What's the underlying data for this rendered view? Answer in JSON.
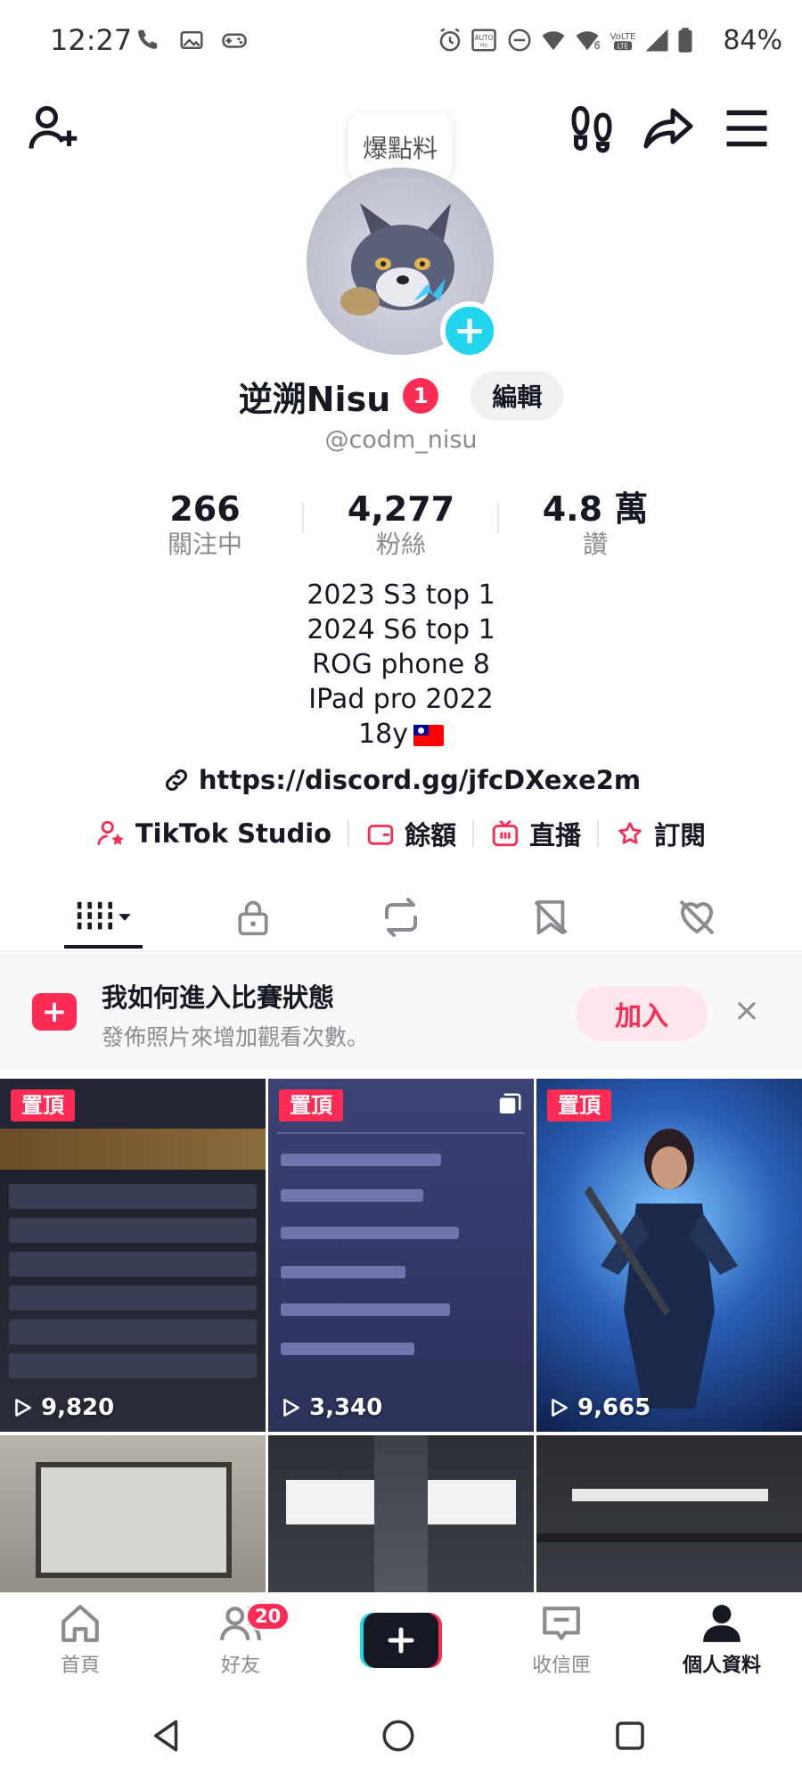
{
  "status_bar": {
    "time": "12:27",
    "battery": "84%",
    "icons_left": [
      "phone-icon",
      "image-icon",
      "gamepad-icon"
    ],
    "icons_right": [
      "alarm-icon",
      "auto-hz-icon",
      "dnd-icon",
      "wifi-icon",
      "wifi6-icon",
      "volte-icon",
      "signal-icon",
      "battery-icon"
    ]
  },
  "top_bar": {
    "bubble_text": "爆點料"
  },
  "profile": {
    "name": "逆溯Nisu",
    "name_badge": "1",
    "edit_label": "編輯",
    "handle": "@codm_nisu"
  },
  "stats": [
    {
      "value": "266",
      "label": "關注中"
    },
    {
      "value": "4,277",
      "label": "粉絲"
    },
    {
      "value": "4.8 萬",
      "label": "讚"
    }
  ],
  "bio": {
    "lines": [
      "2023 S3 top 1",
      "2024 S6 top 1",
      "ROG phone 8",
      "IPad pro 2022",
      "18y"
    ],
    "flag": "taiwan-flag"
  },
  "link": "https://discord.gg/jfcDXexe2m",
  "quick_links": [
    {
      "label": "TikTok Studio",
      "icon": "person-star-icon"
    },
    {
      "label": "餘額",
      "icon": "wallet-icon"
    },
    {
      "label": "直播",
      "icon": "tv-icon"
    },
    {
      "label": "訂閱",
      "icon": "subscribe-icon"
    }
  ],
  "tabs": [
    "videos-grid-icon",
    "private-lock-icon",
    "repost-icon",
    "saved-icon",
    "liked-icon"
  ],
  "banner": {
    "title": "我如何進入比賽狀態",
    "subtitle": "發佈照片來增加觀看次數。",
    "join_label": "加入"
  },
  "videos": [
    {
      "pinned_label": "置頂",
      "views": "9,820",
      "thumb": "leaderboard"
    },
    {
      "pinned_label": "置頂",
      "views": "3,340",
      "thumb": "chat-list"
    },
    {
      "pinned_label": "置頂",
      "views": "9,665",
      "thumb": "soldier-character"
    },
    {
      "pinned_label": "",
      "views": "",
      "thumb": "warehouse"
    },
    {
      "pinned_label": "",
      "views": "",
      "thumb": "ceiling-lights"
    },
    {
      "pinned_label": "",
      "views": "",
      "thumb": "ceiling-lights-2"
    }
  ],
  "bottom_nav": [
    {
      "label": "首頁",
      "icon": "home-icon"
    },
    {
      "label": "好友",
      "icon": "friends-icon",
      "badge": "20"
    },
    {
      "label": "",
      "icon": "create-plus-icon"
    },
    {
      "label": "收信匣",
      "icon": "inbox-icon"
    },
    {
      "label": "個人資料",
      "icon": "profile-icon"
    }
  ],
  "colors": {
    "accent": "#fe2c55",
    "cyan": "#20d5ec",
    "text": "#161823",
    "muted": "#8a8b91"
  }
}
